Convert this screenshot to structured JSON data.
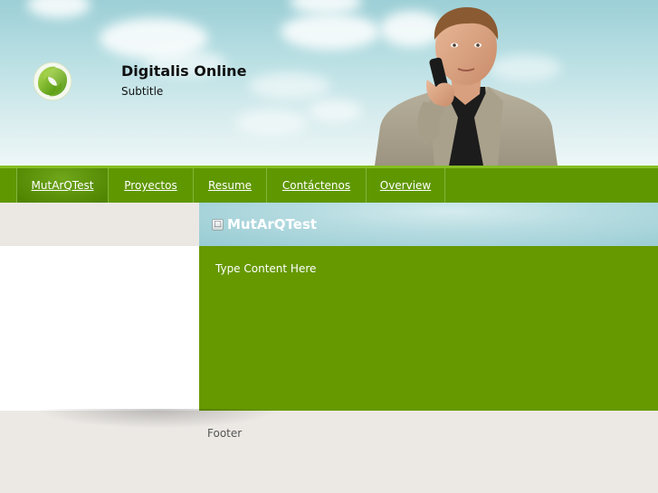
{
  "header": {
    "site_title": "Digitalis Online",
    "site_subtitle": "Subtitle",
    "logo_icon": "leaf-s-logo-icon"
  },
  "nav": {
    "items": [
      {
        "label": "MutArQTest",
        "active": true
      },
      {
        "label": "Proyectos",
        "active": false
      },
      {
        "label": "Resume",
        "active": false
      },
      {
        "label": "Contáctenos",
        "active": false
      },
      {
        "label": "Overview",
        "active": false
      }
    ]
  },
  "content": {
    "title": "MutArQTest",
    "title_icon": "page-icon",
    "body": "Type Content Here"
  },
  "footer": {
    "text": "Footer"
  },
  "colors": {
    "nav_green": "#5f9700",
    "content_green": "#669900",
    "header_sky": "#9ccfd6",
    "content_header_blue": "#97cbd3"
  }
}
